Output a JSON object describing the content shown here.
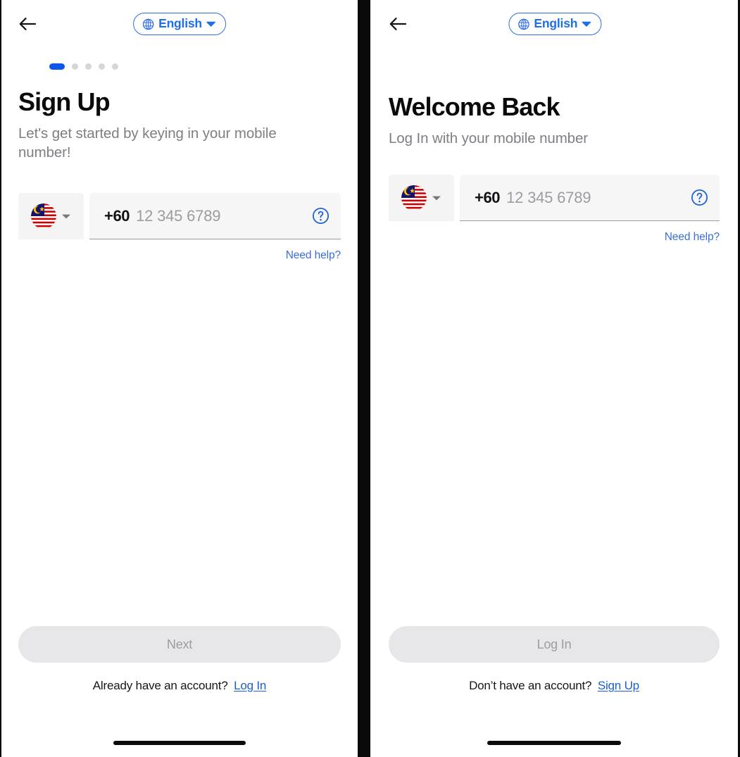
{
  "theme": {
    "accent_blue": "#1f6feb",
    "dot_active_blue": "#0a57e8",
    "link_blue": "#1a5fd0",
    "need_help_blue": "#3b6fd6",
    "muted_gray": "#7d7f84",
    "field_bg": "#f4f4f5",
    "button_disabled_bg": "#e7e7e9",
    "button_disabled_text": "#9b9da1",
    "title_black": "#0b0b0c"
  },
  "screens": [
    {
      "id": "signup",
      "topbar": {
        "back_icon": "arrow-left-icon",
        "language": {
          "icon": "globe-icon",
          "label": "English",
          "caret": "chevron-down-icon"
        }
      },
      "progress": {
        "total": 5,
        "active_index": 0
      },
      "title": "Sign Up",
      "subtitle": "Let's get started by keying in your mobile number!",
      "phone_input": {
        "country_flag": "malaysia-flag-icon",
        "country_caret": "chevron-down-icon",
        "dial_code": "+60",
        "placeholder": "12 345 6789",
        "value": "",
        "help_icon": "question-circle-icon"
      },
      "need_help_label": "Need help?",
      "primary_button": {
        "label": "Next",
        "disabled": true
      },
      "switch": {
        "prompt": "Already have an account?",
        "link": "Log In"
      }
    },
    {
      "id": "login",
      "topbar": {
        "back_icon": "arrow-left-icon",
        "language": {
          "icon": "globe-icon",
          "label": "English",
          "caret": "chevron-down-icon"
        }
      },
      "progress": null,
      "title": "Welcome Back",
      "subtitle": "Log In with your mobile number",
      "phone_input": {
        "country_flag": "malaysia-flag-icon",
        "country_caret": "chevron-down-icon",
        "dial_code": "+60",
        "placeholder": "12 345 6789",
        "value": "",
        "help_icon": "question-circle-icon"
      },
      "need_help_label": "Need help?",
      "primary_button": {
        "label": "Log In",
        "disabled": true
      },
      "switch": {
        "prompt": "Don’t have an account?",
        "link": "Sign Up"
      }
    }
  ]
}
